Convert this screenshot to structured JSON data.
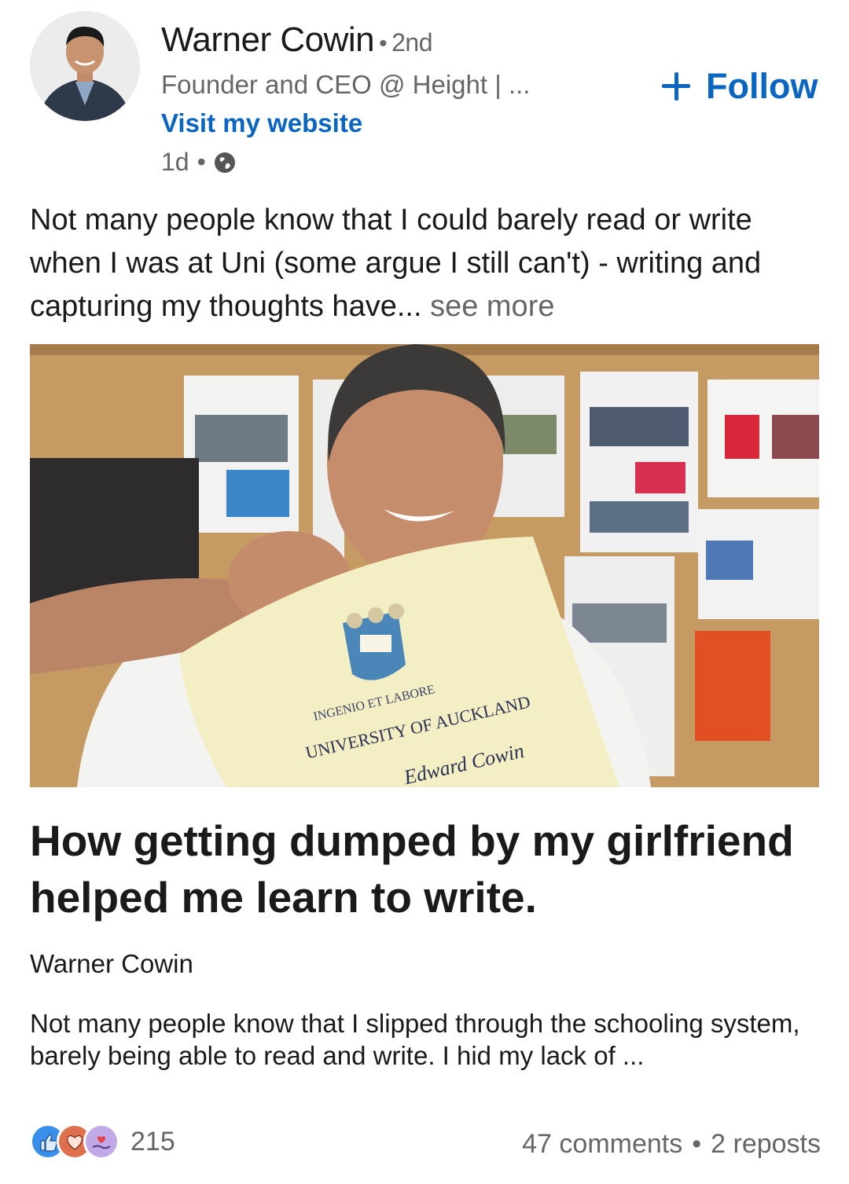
{
  "author": {
    "name": "Warner Cowin",
    "separator": "•",
    "degree": "2nd",
    "headline": "Founder and CEO @ Height | ...",
    "website_link": "Visit my website",
    "time": "1d",
    "meta_separator": "•",
    "visibility_icon": "globe-icon"
  },
  "follow": {
    "label": "Follow",
    "icon": "plus-icon",
    "color": "#0a66c2"
  },
  "post": {
    "text": "Not many people know that I could barely read or write when I was at Uni (some argue I still can't) - writing and capturing my thoughts have...",
    "see_more": "see more"
  },
  "image": {
    "certificate_university": "UNIVERSITY OF AUCKLAND",
    "certificate_name": "Edward Cowin",
    "certificate_motto": "INGENIO ET LABORE"
  },
  "article": {
    "title": "How getting dumped by my girlfriend helped me learn to write.",
    "author": "Warner Cowin",
    "excerpt": "Not many people know that I slipped through the schooling system, barely being able to read and write. I hid my lack of ..."
  },
  "social": {
    "reaction_icons": [
      "like-icon",
      "love-icon",
      "support-icon"
    ],
    "reaction_count": "215",
    "comments": "47 comments",
    "separator": "•",
    "reposts": "2 reposts"
  }
}
